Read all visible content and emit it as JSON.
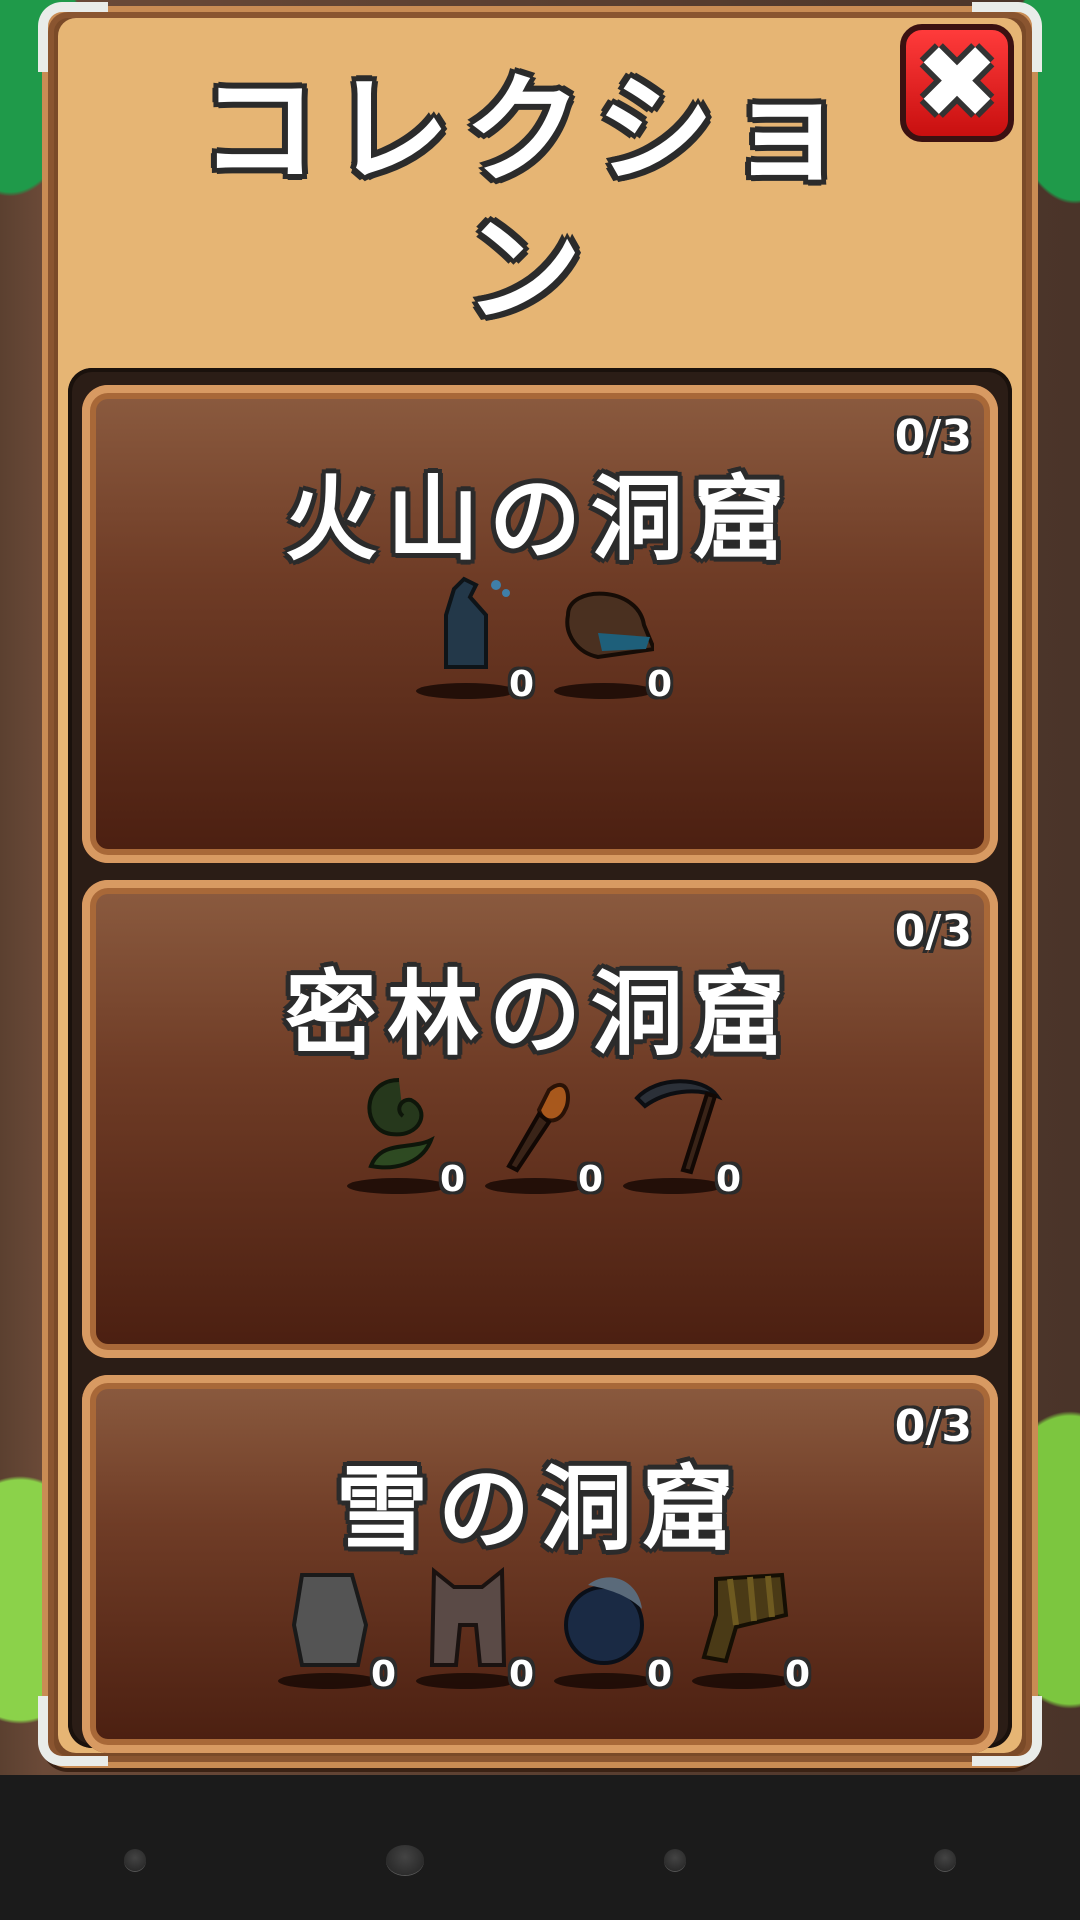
{
  "header": {
    "title": "コレクション",
    "close_label": "✖"
  },
  "cards": [
    {
      "name": "火山の洞窟",
      "progress": "0/3",
      "items": [
        {
          "icon": "potion-bottle-icon",
          "qty": "0"
        },
        {
          "icon": "shell-icon",
          "qty": "0"
        }
      ]
    },
    {
      "name": "密林の洞窟",
      "progress": "0/3",
      "items": [
        {
          "icon": "plant-icon",
          "qty": "0"
        },
        {
          "icon": "torch-icon",
          "qty": "0"
        },
        {
          "icon": "scythe-icon",
          "qty": "0"
        }
      ]
    },
    {
      "name": "雪の洞窟",
      "progress": "0/3",
      "items": [
        {
          "icon": "yeti-icon",
          "qty": "0"
        },
        {
          "icon": "cat-costume-icon",
          "qty": "0"
        },
        {
          "icon": "snowball-icon",
          "qty": "0"
        },
        {
          "icon": "scarf-icon",
          "qty": "0"
        }
      ]
    }
  ],
  "navbar": {
    "buttons": [
      "back-button",
      "home-button",
      "recents-button",
      "menu-button"
    ]
  }
}
